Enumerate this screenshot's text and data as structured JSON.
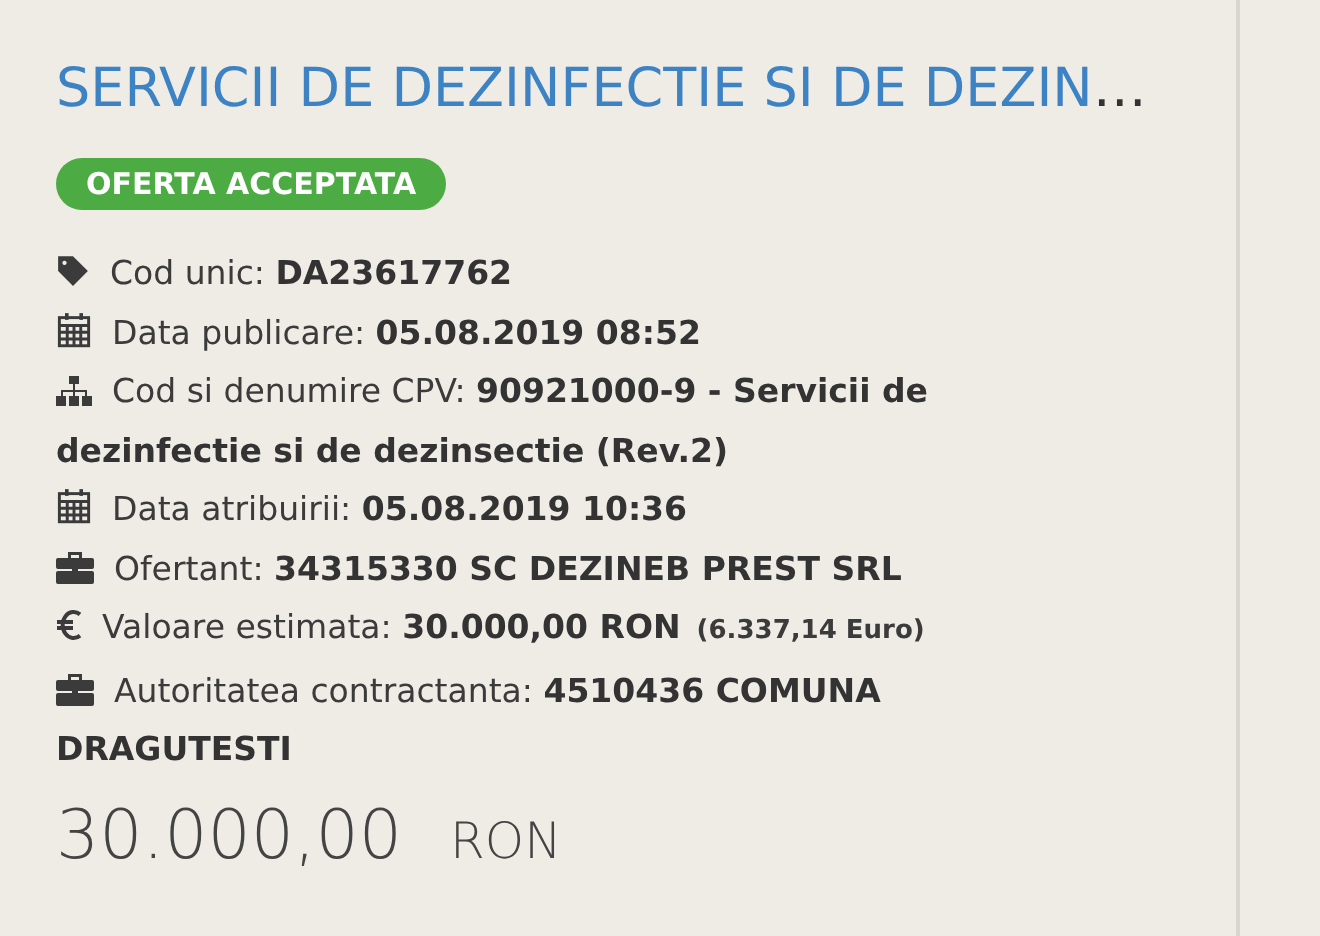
{
  "title": "SERVICII DE DEZINFECTIE SI DE DEZIN",
  "title_ellipsis": "…",
  "status_badge": "OFERTA ACCEPTATA",
  "details": [
    {
      "kind": "tag",
      "text": "Cod unic: **DA23617762**"
    },
    {
      "kind": "calendar",
      "text": "Data publicare: **05.08.2019 08:52**"
    },
    {
      "kind": "sitemap",
      "text": "Cod si denumire CPV: **90921000-9 - Servicii de**",
      "continuation": "dezinfectie si de dezinsectie (Rev.2)"
    },
    {
      "kind": "calendar",
      "text": "Data atribuirii: **05.08.2019 10:36**"
    },
    {
      "kind": "briefcase",
      "text": "Ofertant: **34315330 SC DEZINEB PREST SRL**"
    },
    {
      "kind": "euro",
      "text": "Valoare estimata: **30.000,00  RON**",
      "note": "(6.337,14  Euro)"
    },
    {
      "kind": "briefcase",
      "text": "Autoritatea contractanta: **4510436 COMUNA**",
      "continuation": "DRAGUTESTI"
    }
  ],
  "price": {
    "amount": "30.000,00",
    "currency": "RON"
  }
}
